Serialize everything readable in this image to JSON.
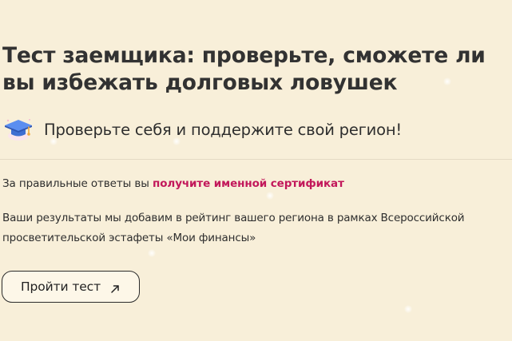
{
  "heading": {
    "title": "Тест заемщика: проверьте, сможете ли вы избежать долговых ловушек"
  },
  "promo": {
    "icon": "graduation-cap-icon",
    "text": "Проверьте себя и поддержите свой регион!"
  },
  "certificate": {
    "prefix": "За правильные ответы вы ",
    "link_text": "получите именной сертификат",
    "link_color": "#c2185b"
  },
  "rating": {
    "text": "Ваши результаты мы добавим в рейтинг вашего региона в рамках Всероссийской просветительской эстафеты «Мои финансы»"
  },
  "cta": {
    "label": "Пройти тест",
    "icon": "arrow-up-right-icon"
  },
  "colors": {
    "background": "#f8efd9",
    "text": "#2e2e2e",
    "accent": "#c2185b"
  }
}
